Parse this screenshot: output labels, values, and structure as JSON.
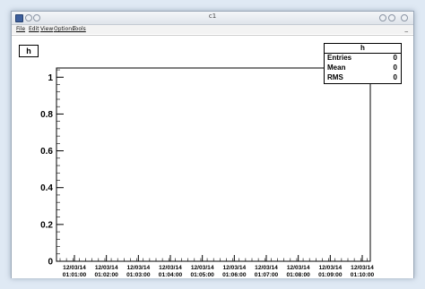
{
  "window": {
    "title": "c1",
    "menu": [
      "File",
      "Edit",
      "View",
      "Options",
      "Tools"
    ],
    "minimize_glyph": "_"
  },
  "histogram": {
    "title": "h",
    "stats": {
      "title": "h",
      "rows": [
        {
          "label": "Entries",
          "value": "0"
        },
        {
          "label": "Mean",
          "value": "0"
        },
        {
          "label": "RMS",
          "value": "0"
        }
      ]
    }
  },
  "chart_data": {
    "type": "bar",
    "title": "h",
    "xlabel": "",
    "ylabel": "",
    "ylim": [
      0,
      1.05
    ],
    "yticks": [
      "0",
      "0.2",
      "0.4",
      "0.6",
      "0.8",
      "1"
    ],
    "ytick_values": [
      0,
      0.2,
      0.4,
      0.6,
      0.8,
      1
    ],
    "xtick_dates": [
      "12/03/14",
      "12/03/14",
      "12/03/14",
      "12/03/14",
      "12/03/14",
      "12/03/14",
      "12/03/14",
      "12/03/14",
      "12/03/14",
      "12/03/14"
    ],
    "xtick_times": [
      "01:01:00",
      "01:02:00",
      "01:03:00",
      "01:04:00",
      "01:05:00",
      "01:06:00",
      "01:07:00",
      "01:08:00",
      "01:09:00",
      "01:10:00"
    ],
    "categories": [
      "12/03/14 01:01:00",
      "12/03/14 01:02:00",
      "12/03/14 01:03:00",
      "12/03/14 01:04:00",
      "12/03/14 01:05:00",
      "12/03/14 01:06:00",
      "12/03/14 01:07:00",
      "12/03/14 01:08:00",
      "12/03/14 01:09:00",
      "12/03/14 01:10:00"
    ],
    "values": [
      0,
      0,
      0,
      0,
      0,
      0,
      0,
      0,
      0,
      0
    ],
    "grid": false,
    "legend": "none"
  }
}
